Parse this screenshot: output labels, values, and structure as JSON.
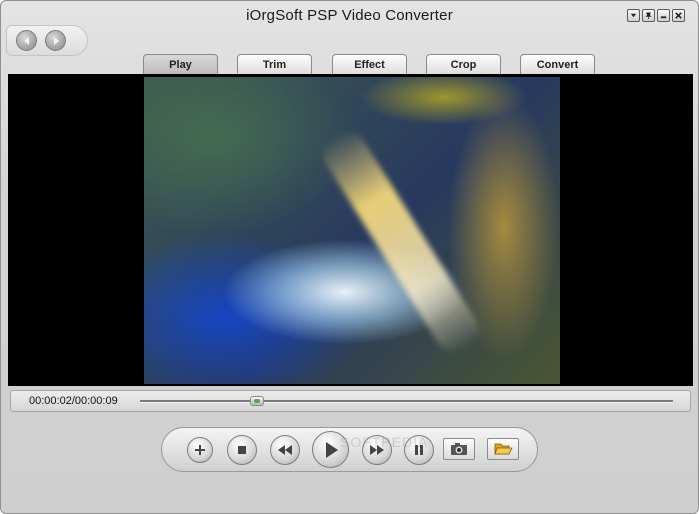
{
  "window": {
    "title": "iOrgSoft PSP Video Converter"
  },
  "window_controls": [
    "dropdown-icon",
    "pin-icon",
    "minimize-icon",
    "close-icon"
  ],
  "nav": {
    "back_icon": "arrow-left-icon",
    "forward_icon": "arrow-right-icon"
  },
  "tabs": [
    {
      "label": "Play",
      "active": true
    },
    {
      "label": "Trim",
      "active": false
    },
    {
      "label": "Effect",
      "active": false
    },
    {
      "label": "Crop",
      "active": false
    },
    {
      "label": "Convert",
      "active": false
    }
  ],
  "player": {
    "time_display": "00:00:02/00:00:09",
    "progress_fraction": 0.22
  },
  "controls": [
    "add-icon",
    "stop-icon",
    "rewind-icon",
    "play-icon",
    "fast-forward-icon",
    "pause-icon",
    "snapshot-icon",
    "open-folder-icon"
  ],
  "watermark": "SOFTPEDIA",
  "colors": {
    "video_background": "#000000",
    "seek_knob_accent": "#48b048"
  }
}
